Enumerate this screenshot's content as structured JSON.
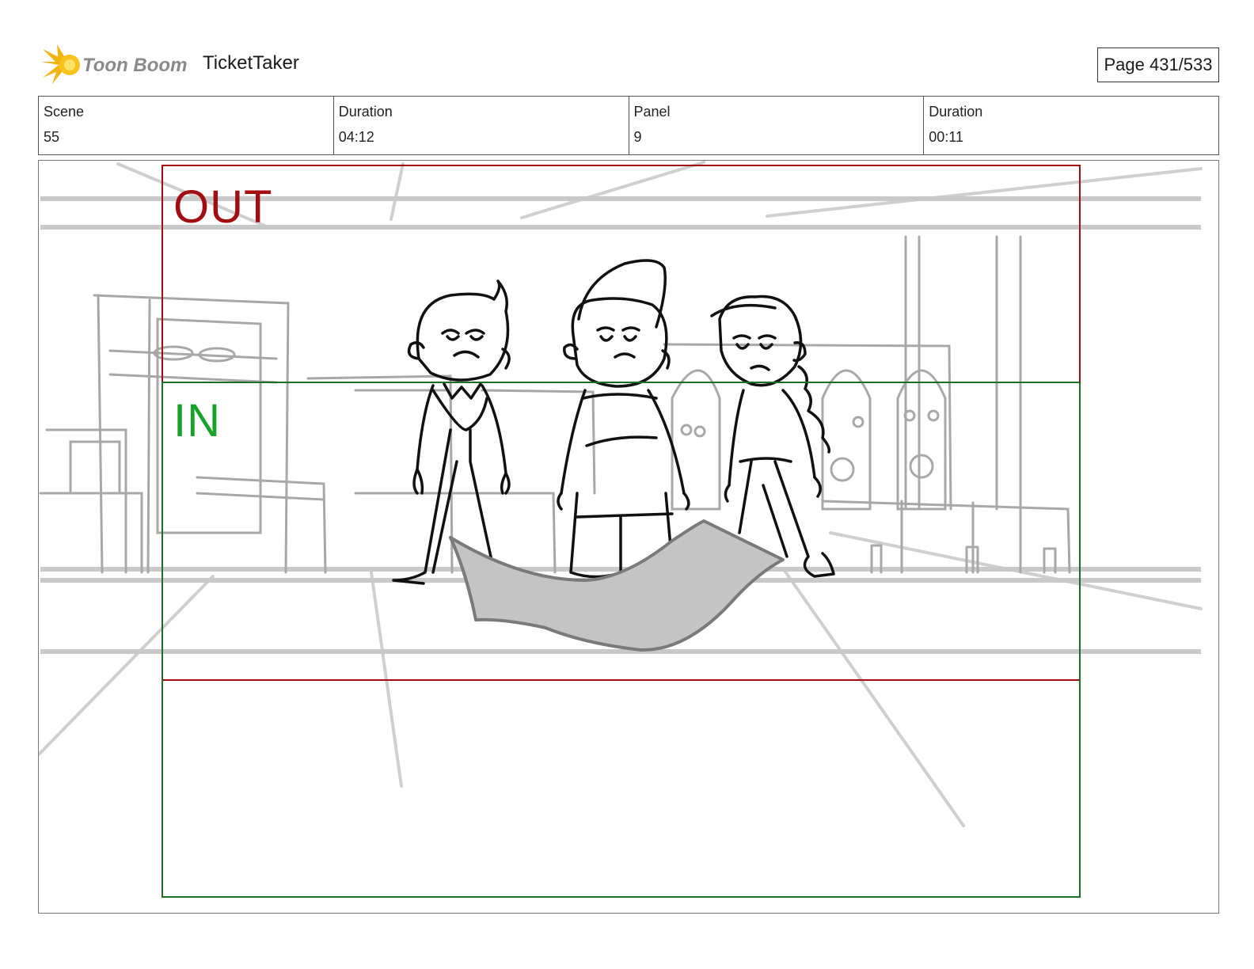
{
  "header": {
    "logo_text": "Toon Boom",
    "project_title": "TicketTaker",
    "page_label": "Page 431/533"
  },
  "info": [
    {
      "label": "Scene",
      "value": "55"
    },
    {
      "label": "Duration",
      "value": "04:12"
    },
    {
      "label": "Panel",
      "value": "9"
    },
    {
      "label": "Duration",
      "value": "00:11"
    }
  ],
  "panel": {
    "out_label": "OUT",
    "in_label": "IN",
    "colors": {
      "out_frame": "#a30d12",
      "in_frame": "#1e6b2a",
      "in_text": "#17a32a",
      "sketch": "#111111",
      "background_sketch": "#a8a8a8"
    }
  }
}
